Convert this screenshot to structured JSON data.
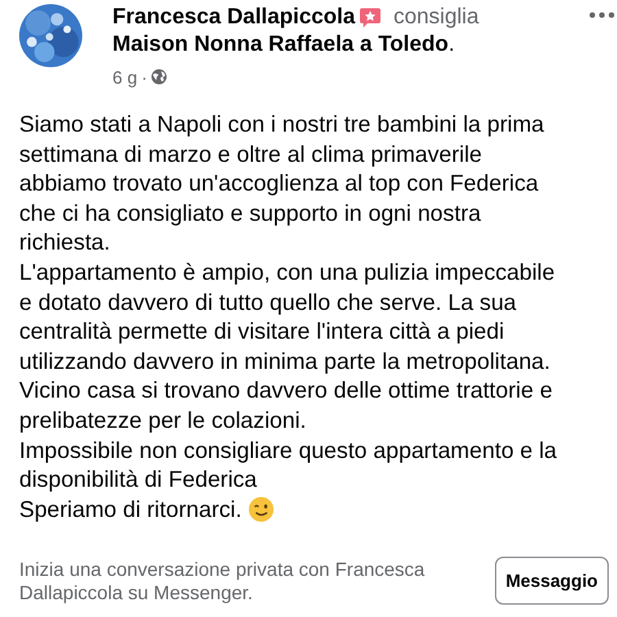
{
  "post": {
    "author": "Francesca Dallapiccola",
    "action": "consiglia",
    "page": "Maison Nonna Raffaela a Toledo",
    "page_end": ".",
    "time": "6 g",
    "separator": "·",
    "body_lines": [
      "Siamo stati a Napoli con i nostri tre bambini la prima",
      "settimana di marzo e oltre al clima primaverile",
      "abbiamo trovato un'accoglienza al top con Federica",
      "che ci ha consigliato e supporto in ogni nostra",
      "richiesta.",
      "L'appartamento è ampio, con una pulizia impeccabile",
      "e dotato davvero di tutto quello che serve. La sua",
      "centralità permette di visitare l'intera città a piedi",
      "utilizzando davvero in minima parte la metropolitana.",
      "Vicino casa si trovano davvero delle ottime trattorie e",
      "prelibatezze per le colazioni.",
      "Impossibile non consigliare questo appartamento e la",
      "disponibilità di Federica",
      "Speriamo di ritornarci."
    ]
  },
  "footer": {
    "text": "Inizia una conversazione privata con Francesca Dallapiccola su Messenger.",
    "button": "Messaggio"
  }
}
